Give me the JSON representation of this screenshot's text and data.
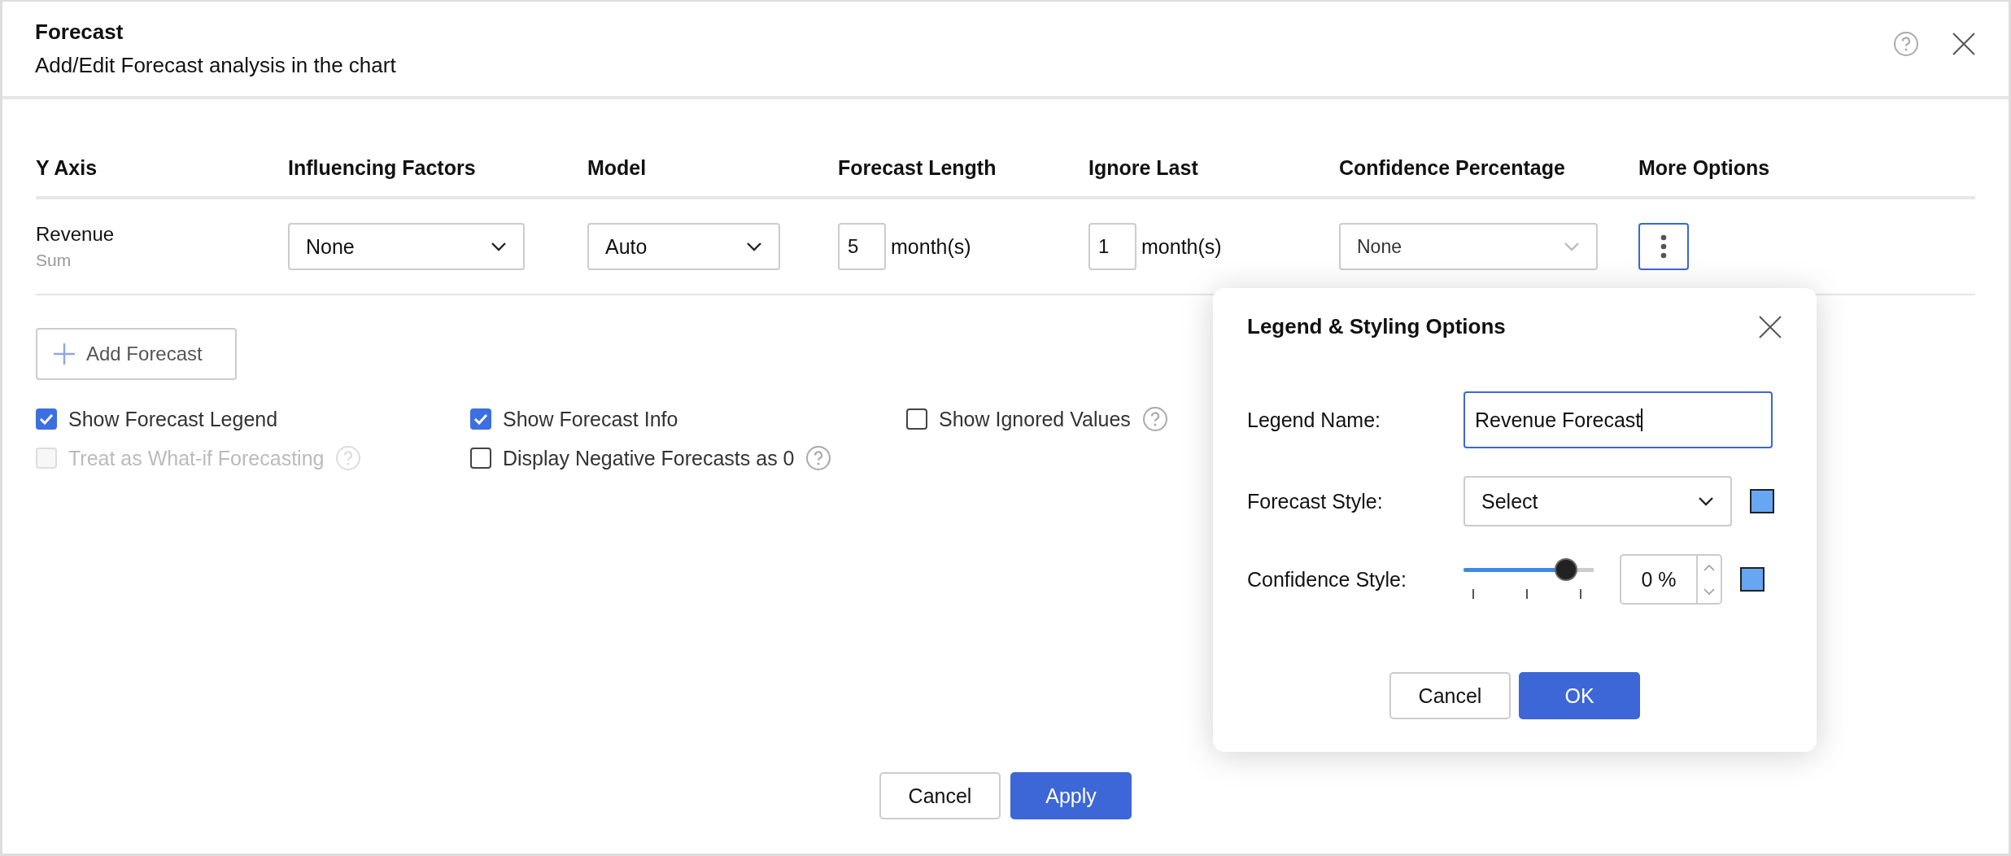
{
  "dialog": {
    "title": "Forecast",
    "subtitle": "Add/Edit Forecast analysis in the chart"
  },
  "table": {
    "columns": [
      "Y Axis",
      "Influencing Factors",
      "Model",
      "Forecast Length",
      "Ignore Last",
      "Confidence Percentage",
      "More Options"
    ],
    "rows": [
      {
        "measure": "Revenue",
        "aggregate": "Sum",
        "influencing_factors": "None",
        "model": "Auto",
        "forecast_length": "5",
        "forecast_length_unit": "month(s)",
        "ignore_last": "1",
        "ignore_last_unit": "month(s)",
        "confidence_percentage": "None",
        "more_options_active": true
      }
    ]
  },
  "add_forecast": "Add Forecast",
  "options": [
    {
      "label": "Show Forecast Legend",
      "checked": true,
      "disabled": false,
      "help": false
    },
    {
      "label": "Show Forecast Info",
      "checked": true,
      "disabled": false,
      "help": false
    },
    {
      "label": "Show Ignored Values",
      "checked": false,
      "disabled": false,
      "help": true
    },
    {
      "label": "Treat as What-if Forecasting",
      "checked": false,
      "disabled": true,
      "help": true
    },
    {
      "label": "Display Negative Forecasts as 0",
      "checked": false,
      "disabled": false,
      "help": true
    }
  ],
  "popup": {
    "title": "Legend & Styling Options",
    "legend_name": {
      "label": "Legend Name:",
      "value": "Revenue Forecast",
      "focused": true
    },
    "forecast_style": {
      "label": "Forecast Style:",
      "value": "Select",
      "color": "#66a6f2"
    },
    "confidence_style": {
      "label": "Confidence Style:",
      "level": 0.79,
      "value": "0 %",
      "color": "#66a6f2"
    },
    "buttons": [
      {
        "label": "Cancel",
        "primary": false
      },
      {
        "label": "OK",
        "primary": true
      }
    ]
  },
  "buttons": [
    {
      "label": "Cancel",
      "primary": false
    },
    {
      "label": "Apply",
      "primary": true
    }
  ]
}
